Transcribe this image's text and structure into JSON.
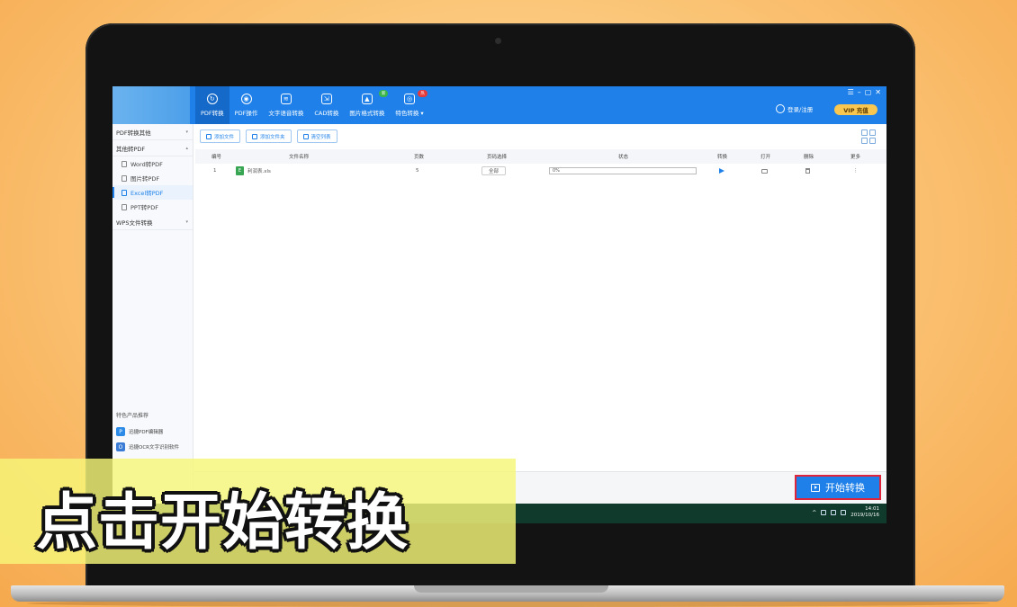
{
  "topbar": {
    "nav": [
      {
        "label": "PDF转换",
        "icon": "pdf-convert-icon",
        "active": true
      },
      {
        "label": "PDF操作",
        "icon": "pdf-operate-icon"
      },
      {
        "label": "文字语音转换",
        "icon": "text-voice-icon"
      },
      {
        "label": "CAD转换",
        "icon": "cad-icon"
      },
      {
        "label": "图片格式转换",
        "icon": "image-icon",
        "badge": "新"
      },
      {
        "label": "特色转换 ▾",
        "icon": "special-icon",
        "badge": "热"
      }
    ],
    "window_controls": [
      "☰",
      "–",
      "▢",
      "✕"
    ],
    "login_label": "登录/注册",
    "vip_label": "VIP 充值"
  },
  "sidebar": {
    "groups": [
      {
        "label": "PDF转换其他"
      },
      {
        "label": "其他转PDF",
        "items": [
          "Word转PDF",
          "图片转PDF",
          "Excel转PDF",
          "PPT转PDF"
        ],
        "active_item": 2
      },
      {
        "label": "WPS文件转换"
      }
    ],
    "promo_title": "特色产品推荐",
    "promos": [
      {
        "label": "迅捷PDF编辑器",
        "icon": "P",
        "color": "#2b8be6"
      },
      {
        "label": "迅捷OCR文字识别软件",
        "icon": "O",
        "color": "#3a7bd5"
      }
    ]
  },
  "toolbar": {
    "add_file": "添加文件",
    "add_folder": "添加文件夹",
    "clear_list": "清空列表"
  },
  "table": {
    "headers": [
      "编号",
      "文件名称",
      "页数",
      "页码选择",
      "状态",
      "转换",
      "打开",
      "删除",
      "更多"
    ],
    "rows": [
      {
        "num": "1",
        "file": "利润表.xls",
        "pages": "5",
        "range": "全部",
        "status": "0%",
        "more": "⋮"
      }
    ]
  },
  "bottom": {
    "start_label": "开始转换"
  },
  "tray": {
    "time": "14:01",
    "date": "2019/10/16"
  },
  "caption": "点击开始转换",
  "colors": {
    "accent": "#1e80e8",
    "highlight_border": "#e0243a",
    "caption_band": "#f6f779"
  }
}
